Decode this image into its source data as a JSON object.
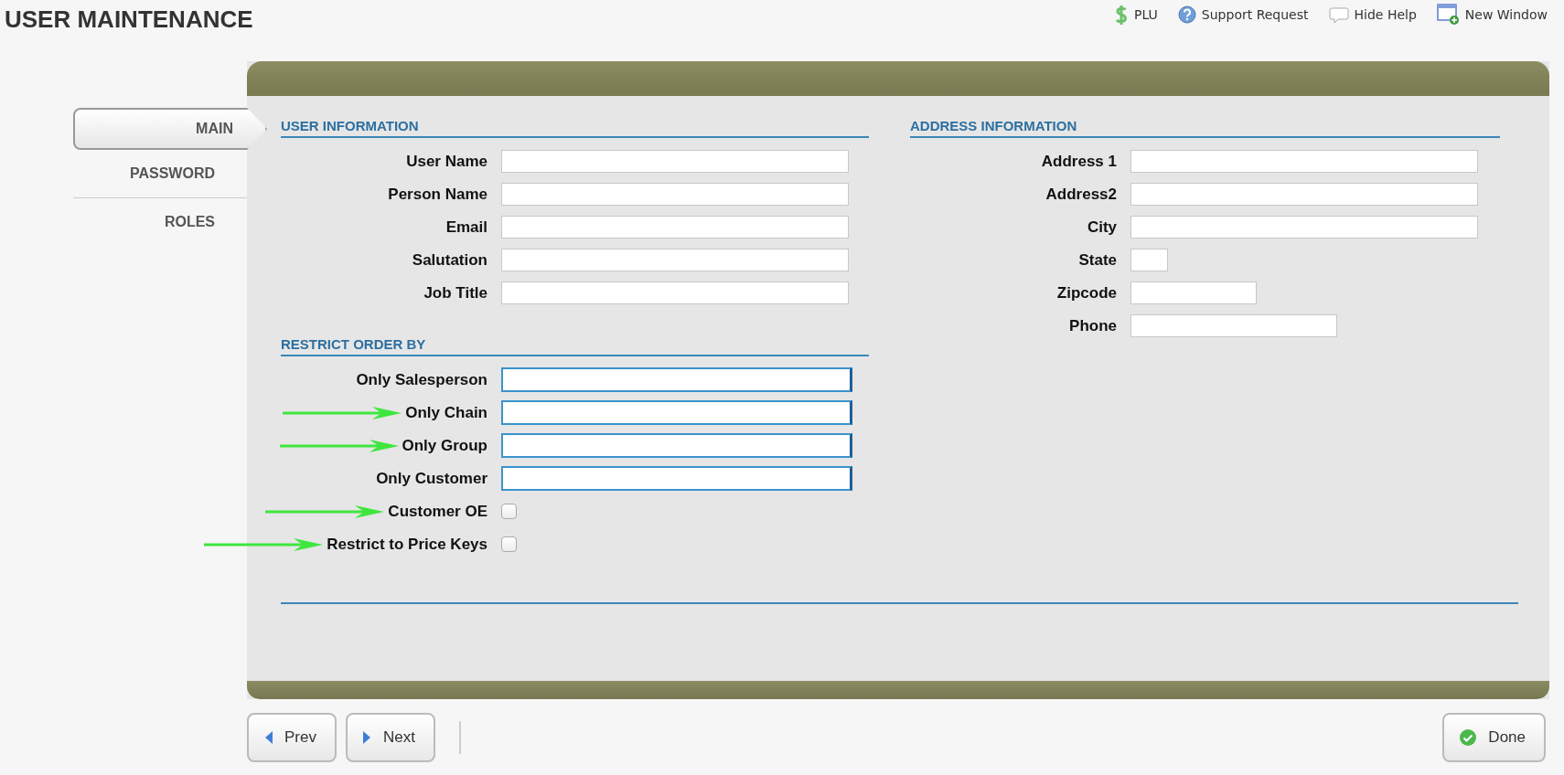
{
  "title": "USER MAINTENANCE",
  "top_links": [
    {
      "kind": "dollar",
      "label": "PLU"
    },
    {
      "kind": "help",
      "label": "Support Request"
    },
    {
      "kind": "bubble",
      "label": "Hide Help"
    },
    {
      "kind": "window",
      "label": "New Window"
    }
  ],
  "tabs": [
    {
      "label": "MAIN",
      "selected": true
    },
    {
      "label": "PASSWORD",
      "selected": false
    },
    {
      "label": "ROLES",
      "selected": false
    }
  ],
  "user_information": {
    "heading": "USER INFORMATION",
    "fields": [
      {
        "label": "User Name",
        "kind": "text",
        "annotated": false
      },
      {
        "label": "Person Name",
        "kind": "text",
        "annotated": false
      },
      {
        "label": "Email",
        "kind": "text",
        "annotated": false
      },
      {
        "label": "Salutation",
        "kind": "text",
        "annotated": false
      },
      {
        "label": "Job Title",
        "kind": "text",
        "annotated": false
      }
    ]
  },
  "restrict_order_by": {
    "heading": "RESTRICT ORDER BY",
    "fields": [
      {
        "label": "Only Salesperson",
        "kind": "lookup",
        "annotated": false
      },
      {
        "label": "Only Chain",
        "kind": "lookup",
        "annotated": true
      },
      {
        "label": "Only Group",
        "kind": "lookup",
        "annotated": true
      },
      {
        "label": "Only Customer",
        "kind": "lookup",
        "annotated": false
      },
      {
        "label": "Customer OE",
        "kind": "checkbox",
        "checked": false,
        "annotated": true
      },
      {
        "label": "Restrict to Price Keys",
        "kind": "checkbox",
        "checked": false,
        "annotated": true
      }
    ]
  },
  "address_information": {
    "heading": "ADDRESS INFORMATION",
    "fields": [
      {
        "label": "Address 1",
        "kind": "text",
        "annotated": false
      },
      {
        "label": "Address2",
        "kind": "text",
        "annotated": false
      },
      {
        "label": "City",
        "kind": "text",
        "annotated": false
      },
      {
        "label": "State",
        "kind": "state",
        "annotated": false
      },
      {
        "label": "Zipcode",
        "kind": "zip",
        "annotated": false
      },
      {
        "label": "Phone",
        "kind": "phone",
        "annotated": false
      }
    ]
  },
  "buttons": [
    {
      "kind": "prev",
      "label": "Prev"
    },
    {
      "kind": "next",
      "label": "Next"
    },
    {
      "kind": "done",
      "label": "Done"
    }
  ]
}
